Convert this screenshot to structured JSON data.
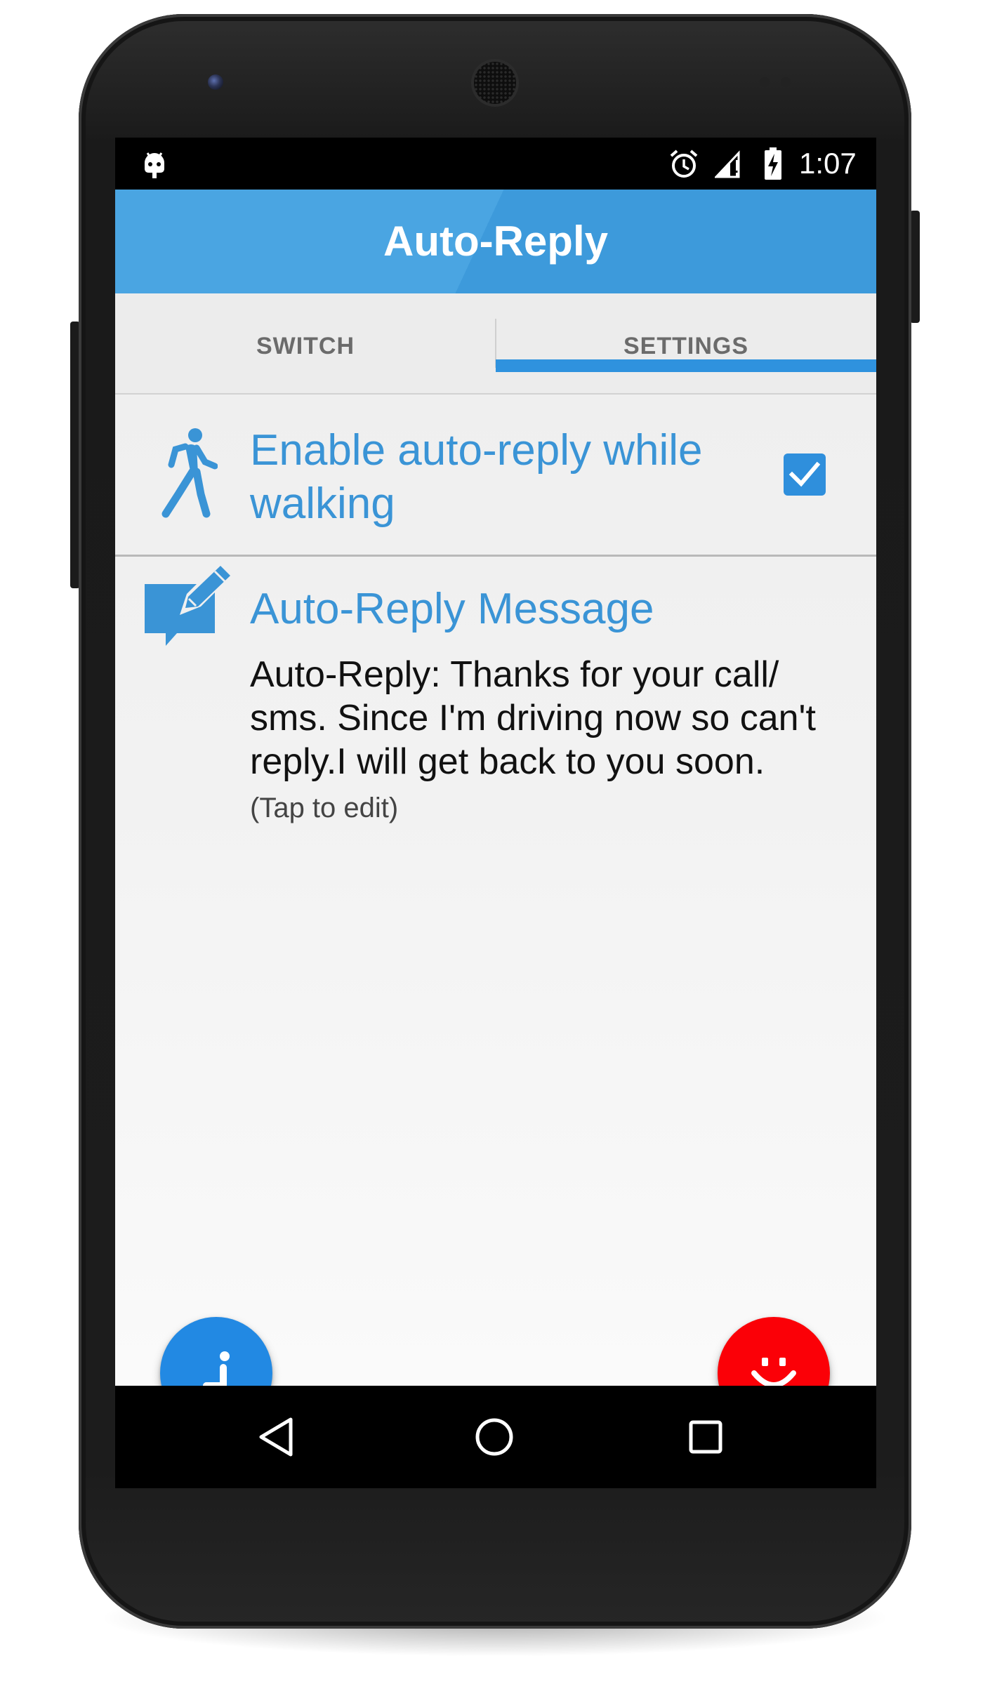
{
  "status_bar": {
    "time": "1:07",
    "icons": [
      "android-debug-icon",
      "alarm-icon",
      "signal-icon",
      "battery-charging-icon"
    ]
  },
  "app_bar": {
    "title": "Auto-Reply",
    "color": "#4aa5e2"
  },
  "tabs": [
    {
      "label": "SWITCH",
      "selected": false
    },
    {
      "label": "SETTINGS",
      "selected": true
    }
  ],
  "settings": {
    "walking": {
      "label": "Enable auto-reply while walking",
      "icon": "walking-person-icon",
      "checked": true
    },
    "message": {
      "title": "Auto-Reply Message",
      "icon": "edit-message-icon",
      "body": "Auto-Reply: Thanks for your call/ sms. Since I'm driving now so can't reply.I will get back to you soon.",
      "hint": "(Tap to edit)"
    }
  },
  "fabs": [
    {
      "icon": "seated-person-icon",
      "color": "#2289e3"
    },
    {
      "icon": "smiley-icon",
      "color": "#fb0007"
    }
  ],
  "nav_bar": {
    "buttons": [
      "back-icon",
      "home-icon",
      "recents-icon"
    ]
  },
  "colors": {
    "accent": "#3a94d6",
    "tab_indicator": "#2f92de",
    "fab_blue": "#2289e3",
    "fab_red": "#fb0007"
  }
}
